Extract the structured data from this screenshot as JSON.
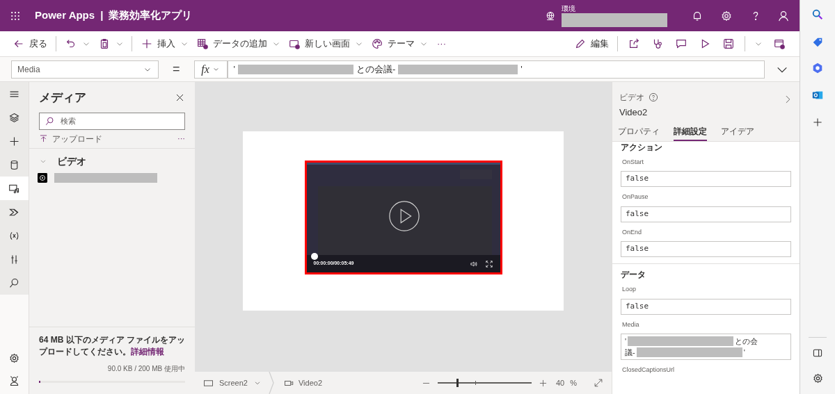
{
  "header": {
    "product": "Power Apps",
    "separator": "|",
    "app_name": "業務効率化アプリ",
    "environment_label": "環境"
  },
  "toolbar": {
    "left": [
      {
        "kind": "back",
        "label": "戻る"
      },
      {
        "kind": "undo"
      },
      {
        "kind": "clipboard"
      },
      {
        "kind": "insert",
        "label": "挿入"
      },
      {
        "kind": "data",
        "label": "データの追加"
      },
      {
        "kind": "screen",
        "label": "新しい画面"
      },
      {
        "kind": "theme",
        "label": "テーマ"
      },
      {
        "kind": "more",
        "label": "···"
      }
    ],
    "edit_label": "編集",
    "right": [
      {
        "kind": "share"
      },
      {
        "kind": "checker"
      },
      {
        "kind": "comment"
      },
      {
        "kind": "play"
      },
      {
        "kind": "save"
      },
      {
        "kind": "publish"
      }
    ]
  },
  "formula_bar": {
    "property": "Media",
    "equals": "=",
    "fx": "fx",
    "prefix": "'",
    "middle": "との会議-",
    "suffix": "'"
  },
  "rail": [
    {
      "kind": "menu",
      "selected": false
    },
    {
      "kind": "layers",
      "selected": false
    },
    {
      "kind": "plus",
      "selected": false
    },
    {
      "kind": "data",
      "selected": false
    },
    {
      "kind": "media",
      "selected": true
    },
    {
      "kind": "flow",
      "selected": false
    },
    {
      "kind": "variables",
      "selected": false
    },
    {
      "kind": "tools",
      "selected": false
    },
    {
      "kind": "search",
      "selected": false
    }
  ],
  "media_panel": {
    "title": "メディア",
    "search": {
      "placeholder": "検索"
    },
    "upload": "アップロード",
    "more": "···",
    "group": {
      "label": "ビデオ",
      "expanded": true
    },
    "footer_text": "64 MB 以下のメディア ファイルをアップロードしてください。",
    "footer_link": "詳細情報",
    "usage": "90.0 KB / 200 MB 使用中",
    "usage_bar": {
      "level": 0.01
    }
  },
  "video": {
    "time": "00:00:00/00:05:49",
    "seek": {
      "level": 0
    }
  },
  "status_bar": {
    "screen": "Screen2",
    "control": "Video2",
    "zoom_slider": {
      "level": 0.2
    },
    "zoom": "40",
    "percent": "%"
  },
  "properties": {
    "type": "ビデオ",
    "name": "Video2",
    "tabs": [
      {
        "label": "プロパティ",
        "selected": false
      },
      {
        "label": "詳細設定",
        "selected": true
      },
      {
        "label": "アイデア",
        "selected": false
      }
    ],
    "sections": [
      {
        "title": "アクション",
        "fields": [
          {
            "label": "OnStart",
            "value": "false"
          },
          {
            "label": "OnPause",
            "value": "false"
          },
          {
            "label": "OnEnd",
            "value": "false"
          }
        ]
      },
      {
        "title": "データ",
        "fields": [
          {
            "label": "Loop",
            "value": "false"
          },
          {
            "label": "Media",
            "kind": "media"
          },
          {
            "label": "ClosedCaptionsUrl",
            "kind": "cut"
          }
        ]
      }
    ],
    "media_value": {
      "line1_start": "'",
      "line1_end": "との会",
      "line2_start": "議-",
      "line2_end": "'"
    }
  }
}
